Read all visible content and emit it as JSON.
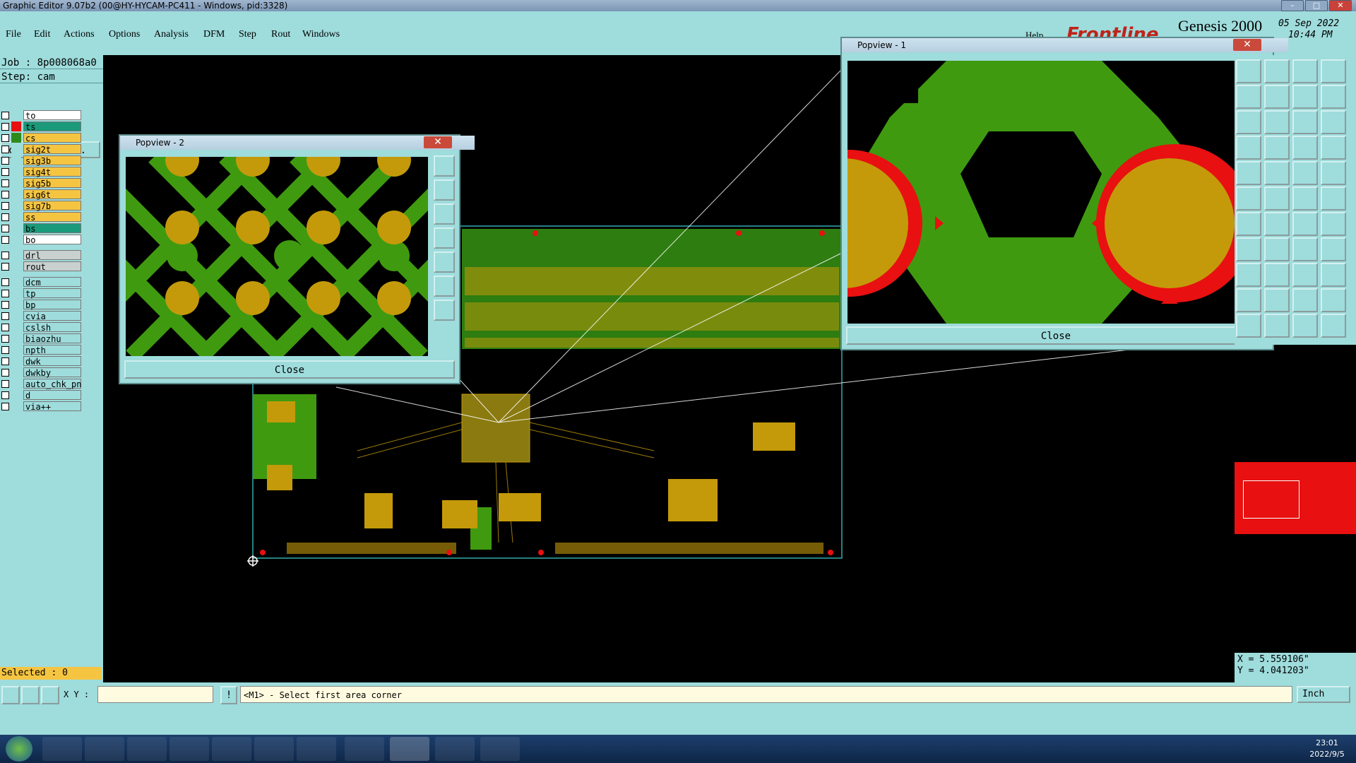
{
  "window": {
    "title": "Graphic Editor 9.07b2 (00@HY-HYCAM-PC411 - Windows, pid:3328)"
  },
  "menu": [
    "File",
    "Edit",
    "Actions",
    "Options",
    "Analysis",
    "DFM",
    "Step",
    "Rout",
    "Windows"
  ],
  "help_label": "Help",
  "branding": {
    "vendor": "Frontline",
    "product": "Genesis 2000",
    "date": "05 Sep 2022",
    "time": "10:44 PM"
  },
  "job": {
    "job_line": "Job : 8p008068a0",
    "step_line": "Step: cam",
    "job_matrix_label": "Job Matrix ..."
  },
  "layers": [
    {
      "name": "to",
      "color": "#ffffff",
      "swatch": "#9fdcdc"
    },
    {
      "name": "ts",
      "color": "#1a9a7a",
      "swatch": "#e81010"
    },
    {
      "name": "cs",
      "color": "#f5c542",
      "swatch": "#2e8b1a"
    },
    {
      "name": "sig2t",
      "color": "#f5c542",
      "swatch": "#9fdcdc"
    },
    {
      "name": "sig3b",
      "color": "#f5c542",
      "swatch": "#9fdcdc"
    },
    {
      "name": "sig4t",
      "color": "#f5c542",
      "swatch": "#9fdcdc"
    },
    {
      "name": "sig5b",
      "color": "#f5c542",
      "swatch": "#9fdcdc"
    },
    {
      "name": "sig6t",
      "color": "#f5c542",
      "swatch": "#9fdcdc"
    },
    {
      "name": "sig7b",
      "color": "#f5c542",
      "swatch": "#9fdcdc"
    },
    {
      "name": "ss",
      "color": "#f5c542",
      "swatch": "#9fdcdc"
    },
    {
      "name": "bs",
      "color": "#1a9a7a",
      "swatch": "#9fdcdc"
    },
    {
      "name": "bo",
      "color": "#ffffff",
      "swatch": "#9fdcdc"
    },
    {
      "name": "drl",
      "color": "#c8d0d0",
      "swatch": "#9fdcdc"
    },
    {
      "name": "rout",
      "color": "#c8d0d0",
      "swatch": "#9fdcdc"
    },
    {
      "name": "dcm",
      "color": "#9fdcdc",
      "swatch": "#9fdcdc"
    },
    {
      "name": "tp",
      "color": "#9fdcdc",
      "swatch": "#9fdcdc"
    },
    {
      "name": "bp",
      "color": "#9fdcdc",
      "swatch": "#9fdcdc"
    },
    {
      "name": "cvia",
      "color": "#9fdcdc",
      "swatch": "#9fdcdc"
    },
    {
      "name": "cslsh",
      "color": "#9fdcdc",
      "swatch": "#9fdcdc"
    },
    {
      "name": "biaozhu",
      "color": "#9fdcdc",
      "swatch": "#9fdcdc"
    },
    {
      "name": "npth",
      "color": "#9fdcdc",
      "swatch": "#9fdcdc"
    },
    {
      "name": "dwk",
      "color": "#9fdcdc",
      "swatch": "#9fdcdc"
    },
    {
      "name": "dwkby",
      "color": "#9fdcdc",
      "swatch": "#9fdcdc"
    },
    {
      "name": "auto_chk_pn",
      "color": "#9fdcdc",
      "swatch": "#9fdcdc"
    },
    {
      "name": "d",
      "color": "#9fdcdc",
      "swatch": "#9fdcdc"
    },
    {
      "name": "via++",
      "color": "#9fdcdc",
      "swatch": "#9fdcdc"
    }
  ],
  "selected_label": "Selected : 0",
  "popview1": {
    "title": "Popview - 1",
    "close_label": "Close"
  },
  "popview2": {
    "title": "Popview - 2",
    "close_label": "Close"
  },
  "coordinates": {
    "x_line": "X = 5.559106\"",
    "y_line": "Y = 4.041203\""
  },
  "command": {
    "xy_label": "X Y :",
    "prompt": "<M1> - Select first area corner",
    "unit": "Inch"
  },
  "clock": {
    "time": "23:01",
    "date": "2022/9/5"
  },
  "colors": {
    "panel": "#9fdcdc",
    "copper_green": "#3f9a10",
    "pad_gold": "#c49a0a",
    "mark_red": "#e81010"
  }
}
